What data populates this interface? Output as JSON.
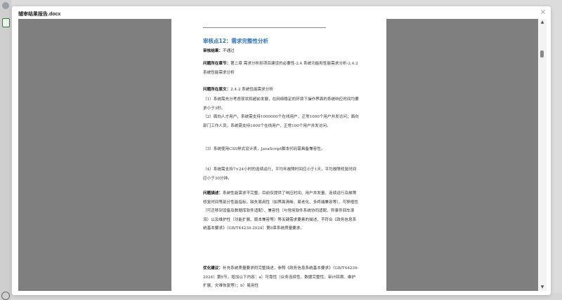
{
  "dialog": {
    "title": "辅审结果报告.docx",
    "close_icon": "×"
  },
  "scroll": {
    "up": "▲",
    "down": "▼"
  },
  "document": {
    "heading": "审核点12：需求完整性分析",
    "result_label": "审核结果：",
    "result_value": "不通过",
    "location_label": "问题所在章节：",
    "location_value": "第二章 需求分析和项目建设的必要性-2.4 系统功能和性能需求分析-2.4.2 系统性能需求分析",
    "original_label": "问题所在原文：",
    "original_value": "2.4.2 系统性能需求分析",
    "items": [
      "（1）系统需充分考虑现状和超前发展，在网络稳定的环境下操作界面的系统响应时间均要求小于3秒。",
      "（2）面向人才用户，系统需支持1000000个在线用户，正常1000个用户并发访问；面向部门工作人员，系统需支持1000个在线用户，正常100个用户并发访问。",
      "（3）系统使用CSS样式设计表，JavaScript脚本代码需具备兼容性。",
      "（4）系统需支持7×24小时的连续运行，平均年故障时间应小于1天，平均故障修复时间应小于30分钟。"
    ],
    "desc_label": "问题描述：",
    "desc_value": "系统性能需求不完整。目前仅提供了响应时间、用户并发量、连续运行及故障修复时间等部分性能指标，缺失易用性（如界面清晰、易老化、多终端兼容等）、可移植性（可迁移到设备及数据库软件适配）、兼容性（与常用软件系统协同适配、异事件回车滚流）以及维护性（功能扩展、版本兼容等）等关键需求要素的描述，不符合《政务信息系统基本要求》（GB/T44230-2024）第8章系统质量要求。",
    "suggest_label": "优化建议：",
    "suggest_value": "补充系统质量要求的完整描述，参照《政务信息系统基本要求》（GB/T44230-2024）第8节，增加以下内容：a）可靠性（业务连续性、数据完整性、审计回溯、维护扩展、灾难恢复等）；b）易用性"
  }
}
